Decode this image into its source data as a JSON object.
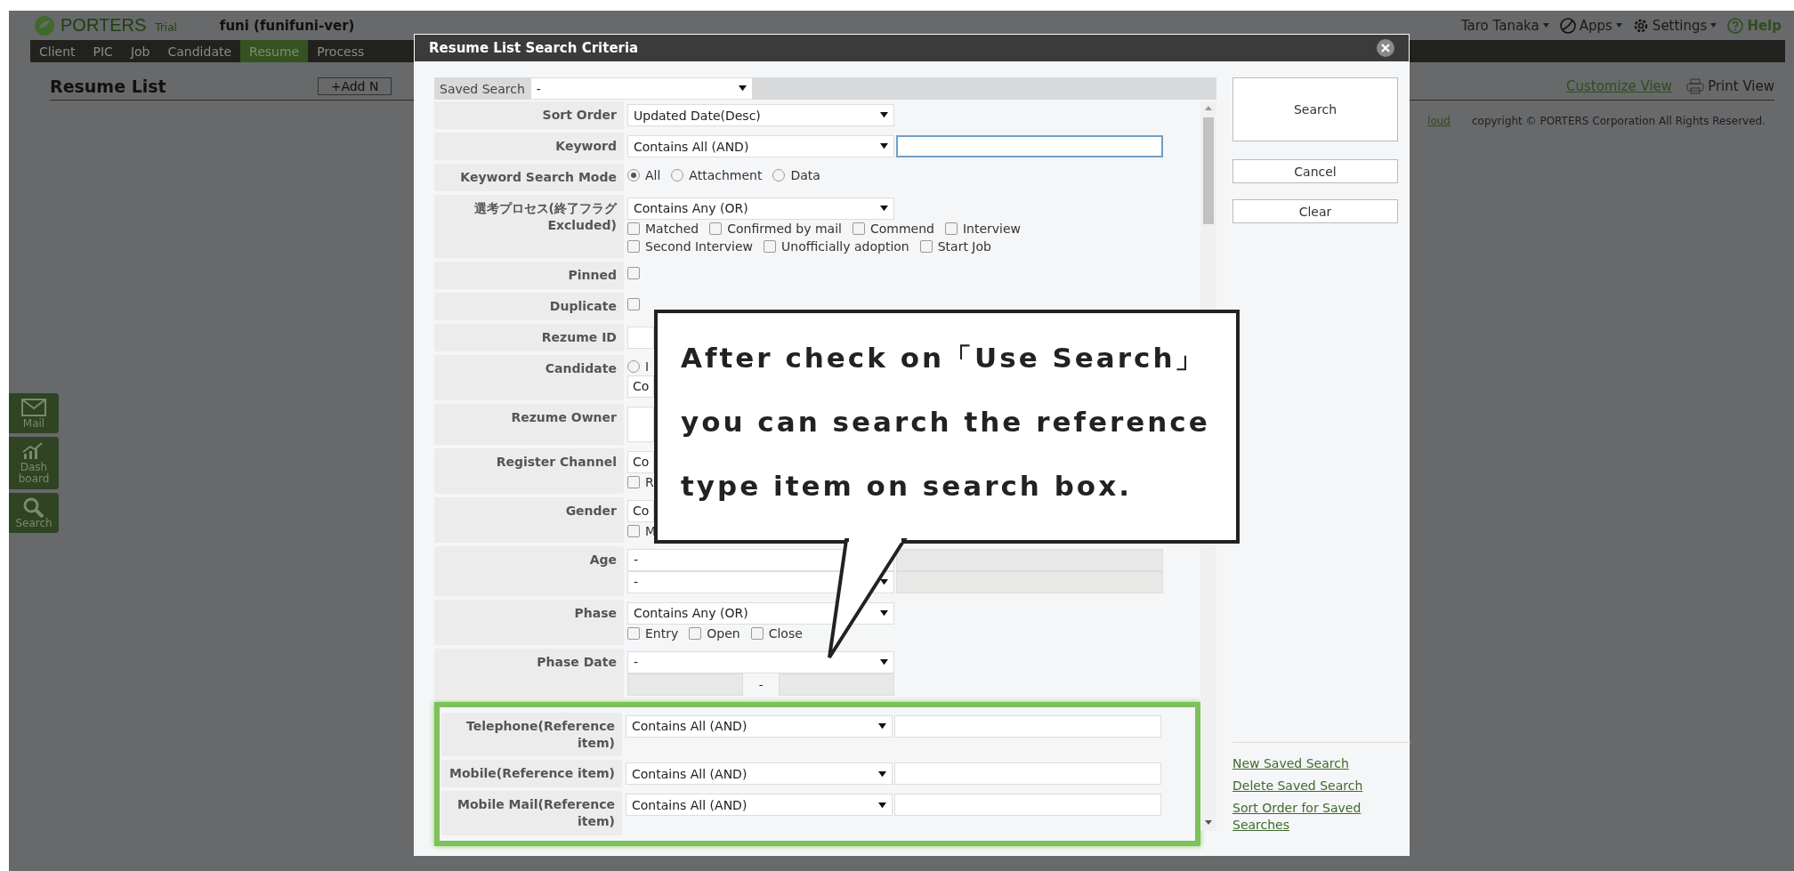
{
  "page": {
    "logo": "PORTERS",
    "edition": "Trial",
    "account": "funi (funifuni-ver)",
    "nav": [
      {
        "label": "Client",
        "selected": false
      },
      {
        "label": "PIC",
        "selected": false
      },
      {
        "label": "Job",
        "selected": false
      },
      {
        "label": "Candidate",
        "selected": false
      },
      {
        "label": "Resume",
        "selected": true
      },
      {
        "label": "Process",
        "selected": false
      }
    ],
    "user_menu": [
      {
        "kind": "user",
        "label": "Taro Tanaka"
      },
      {
        "kind": "apps",
        "label": "Apps"
      },
      {
        "kind": "settings",
        "label": "Settings"
      },
      {
        "kind": "help",
        "label": "Help"
      }
    ],
    "title": "Resume List",
    "add_button": "+Add N",
    "view_links": [
      {
        "kind": "customize",
        "label": "Customize View"
      },
      {
        "kind": "print",
        "label": "Print View"
      }
    ],
    "footer_link": "loud",
    "copyright": "copyright © PORTERS Corporation All Rights Reserved.",
    "side_buttons": [
      {
        "kind": "mail",
        "label": "Mail"
      },
      {
        "kind": "dashboard",
        "label": "Dash board"
      },
      {
        "kind": "search",
        "label": "Search"
      }
    ]
  },
  "dialog": {
    "title": "Resume List Search Criteria",
    "saved_search": {
      "label": "Saved Search",
      "value": "-"
    },
    "rows": [
      {
        "label": "Sort Order",
        "lines": [
          [
            {
              "kind": "select",
              "value": "Updated Date(Desc)"
            }
          ]
        ]
      },
      {
        "label": "Keyword",
        "lines": [
          [
            {
              "kind": "select",
              "value": "Contains All (AND)"
            },
            {
              "kind": "input",
              "focused": true
            }
          ]
        ]
      },
      {
        "label": "Keyword Search Mode",
        "lines": [
          [
            {
              "kind": "radio",
              "label": "All",
              "checked": true
            },
            {
              "kind": "radio",
              "label": "Attachment",
              "checked": false
            },
            {
              "kind": "radio",
              "label": "Data",
              "checked": false
            }
          ]
        ]
      },
      {
        "label": "選考プロセス(終了フラグ Excluded)",
        "lines": [
          [
            {
              "kind": "select",
              "value": "Contains Any (OR)"
            }
          ],
          [
            {
              "kind": "check",
              "label": "Matched",
              "checked": false
            },
            {
              "kind": "check",
              "label": "Confirmed by mail",
              "checked": false
            },
            {
              "kind": "check",
              "label": "Commend",
              "checked": false
            },
            {
              "kind": "check",
              "label": "Interview",
              "checked": false
            }
          ],
          [
            {
              "kind": "check",
              "label": "Second Interview",
              "checked": false
            },
            {
              "kind": "check",
              "label": "Unofficially adoption",
              "checked": false
            },
            {
              "kind": "check",
              "label": "Start Job",
              "checked": false
            }
          ]
        ]
      },
      {
        "label": "Pinned",
        "lines": [
          [
            {
              "kind": "check",
              "checked": false
            }
          ]
        ]
      },
      {
        "label": "Duplicate",
        "lines": [
          [
            {
              "kind": "check",
              "checked": false
            }
          ]
        ]
      },
      {
        "label": "Rezume ID",
        "lines": [
          [
            {
              "kind": "input"
            }
          ]
        ]
      },
      {
        "label": "Candidate",
        "lines": [
          [
            {
              "kind": "radio",
              "label": "I",
              "checked": false
            }
          ],
          [
            {
              "kind": "select",
              "value": "Co"
            }
          ]
        ]
      },
      {
        "label": "Rezume Owner",
        "lines": [
          [
            {
              "kind": "tall_input"
            }
          ]
        ]
      },
      {
        "label": "Register Channel",
        "lines": [
          [
            {
              "kind": "select",
              "value": "Co"
            }
          ],
          [
            {
              "kind": "check",
              "label": "R",
              "checked": false
            }
          ]
        ]
      },
      {
        "label": "Gender",
        "lines": [
          [
            {
              "kind": "select",
              "value": "Co"
            }
          ],
          [
            {
              "kind": "check",
              "label": "M",
              "checked": false
            }
          ]
        ]
      },
      {
        "label": "Age",
        "lines": [
          [
            {
              "kind": "select",
              "value": "-"
            },
            {
              "kind": "input",
              "disabled": true
            }
          ],
          [
            {
              "kind": "select",
              "value": "-"
            },
            {
              "kind": "input",
              "disabled": true
            }
          ]
        ]
      },
      {
        "label": "Phase",
        "lines": [
          [
            {
              "kind": "select",
              "value": "Contains Any (OR)"
            }
          ],
          [
            {
              "kind": "check",
              "label": "Entry",
              "checked": false
            },
            {
              "kind": "check",
              "label": "Open",
              "checked": false
            },
            {
              "kind": "check",
              "label": "Close",
              "checked": false
            }
          ]
        ]
      },
      {
        "label": "Phase Date",
        "lines": [
          [
            {
              "kind": "select",
              "value": "-"
            }
          ],
          [
            {
              "kind": "short_input",
              "disabled": true
            },
            {
              "kind": "dash",
              "text": "-"
            },
            {
              "kind": "short_input",
              "disabled": true
            }
          ]
        ]
      },
      {
        "label": "Telephone(Reference item)",
        "highlighted": true,
        "lines": [
          [
            {
              "kind": "select",
              "value": "Contains All (AND)"
            },
            {
              "kind": "input"
            }
          ]
        ]
      },
      {
        "label": "Mobile(Reference item)",
        "highlighted": true,
        "lines": [
          [
            {
              "kind": "select",
              "value": "Contains All (AND)"
            },
            {
              "kind": "input"
            }
          ]
        ]
      },
      {
        "label": "Mobile Mail(Reference item)",
        "highlighted": true,
        "lines": [
          [
            {
              "kind": "select",
              "value": "Contains All (AND)"
            },
            {
              "kind": "input"
            }
          ]
        ]
      }
    ],
    "buttons": [
      {
        "kind": "primary",
        "label": "Search"
      },
      {
        "kind": "secondary",
        "label": "Cancel"
      },
      {
        "kind": "secondary",
        "label": "Clear"
      }
    ],
    "links": [
      "New Saved Search",
      "Delete Saved Search",
      "Sort Order for Saved Searches"
    ]
  },
  "callout": {
    "lines": [
      "After check on「Use Search」",
      "you can search the reference",
      "type item on search box."
    ]
  }
}
